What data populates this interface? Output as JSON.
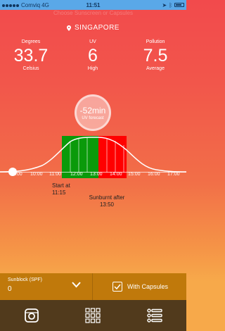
{
  "status_bar": {
    "carrier": "Comviq",
    "network": "4G",
    "time": "11:51"
  },
  "header": {
    "faded_title": "Choose Sunscreen or Capsules",
    "location": "SINGAPORE"
  },
  "metrics": [
    {
      "label": "Degrees",
      "value": "33.7",
      "sub": "Celsius"
    },
    {
      "label": "UV",
      "value": "6",
      "sub": "High"
    },
    {
      "label": "Pollution",
      "value": "7.5",
      "sub": "Average"
    }
  ],
  "uv_forecast": {
    "time": "-52min",
    "caption": "UV forecast"
  },
  "chart_data": {
    "type": "area",
    "title": "",
    "x_unit": "time of day",
    "tick_labels": [
      "9:00",
      "10:00",
      "11:00",
      "12:00",
      "13:00",
      "14:00",
      "15:00",
      "16:00",
      "17:00"
    ],
    "highlight_safe": {
      "from": "11:15",
      "to": "13:50",
      "color": "#0a9a0a"
    },
    "highlight_burn": {
      "from": "13:50",
      "to": "16:00",
      "color": "#ff0000"
    },
    "current_marker": "8:30",
    "annotations": [
      {
        "text": "Start at 11:15"
      },
      {
        "text": "Sunburnt after 13:50"
      }
    ]
  },
  "sunblock": {
    "label": "Sunblock (SPF)",
    "value": "0"
  },
  "capsules": {
    "label": "With Capsules",
    "checked": true
  },
  "tabs": [
    {
      "icon": "instagram-icon"
    },
    {
      "icon": "grid-icon"
    },
    {
      "icon": "list-icon"
    }
  ],
  "colors": {
    "accent_red": "#f24a4c",
    "bottom_bar": "#c0790b",
    "tab_bar": "#513a1c",
    "safe_green": "#0a9a0a",
    "burn_red": "#ff0000"
  }
}
